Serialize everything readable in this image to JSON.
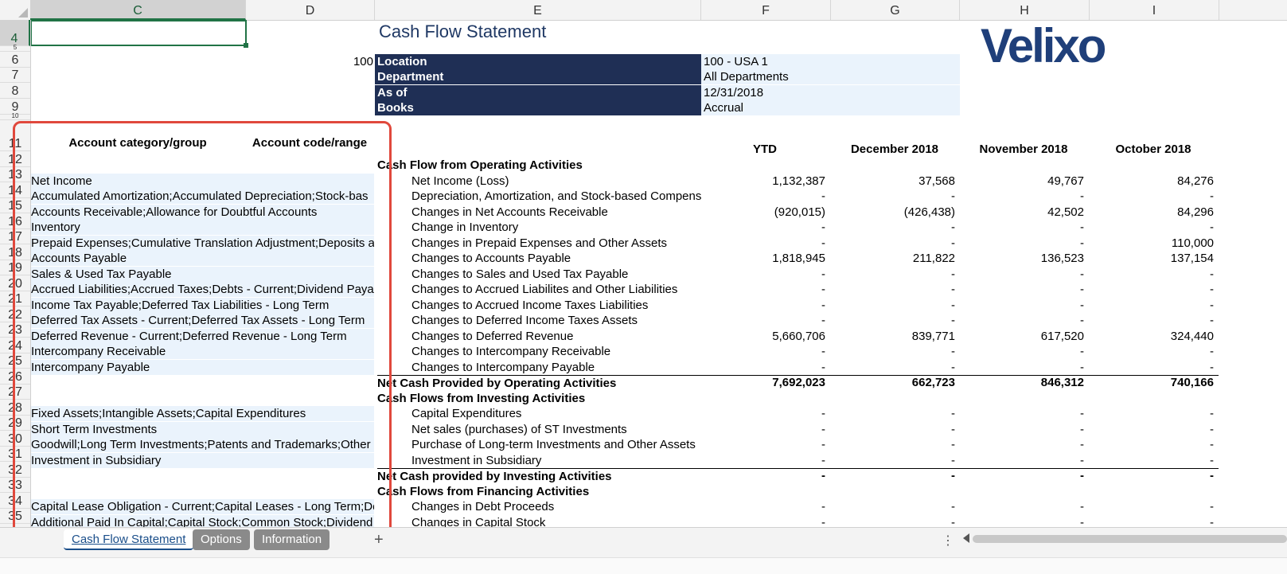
{
  "columns": [
    "C",
    "D",
    "E",
    "F",
    "G",
    "H",
    "I"
  ],
  "rows": [
    "4",
    "5",
    "6",
    "7",
    "8",
    "9",
    "10",
    "11",
    "12",
    "13",
    "14",
    "15",
    "16",
    "17",
    "18",
    "19",
    "20",
    "21",
    "22",
    "23",
    "24",
    "25",
    "26",
    "27",
    "28",
    "29",
    "30",
    "31",
    "32",
    "33",
    "34",
    "35"
  ],
  "report": {
    "title": "Cash Flow Statement",
    "location_code": "100",
    "header_labels": [
      "Location",
      "Department",
      "As of",
      "Books"
    ],
    "header_values": [
      "100 - USA 1",
      "All Departments",
      "12/31/2018",
      "Accrual"
    ],
    "logo_text": "Velixo"
  },
  "mapping_headers": {
    "category": "Account category/group",
    "code": "Account code/range"
  },
  "period_headers": [
    "YTD",
    "December 2018",
    "November 2018",
    "October 2018"
  ],
  "lines": [
    {
      "row": "12",
      "cat": "",
      "label": "Cash Flow from Operating Activities",
      "section": true,
      "vals": [
        "",
        "",
        "",
        ""
      ]
    },
    {
      "row": "13",
      "cat": "Net Income",
      "label": "Net Income (Loss)",
      "vals": [
        "1,132,387",
        "37,568",
        "49,767",
        "84,276"
      ]
    },
    {
      "row": "14",
      "cat": "Accumulated Amortization;Accumulated Depreciation;Stock-bas",
      "label": "Depreciation, Amortization, and Stock-based Compens",
      "vals": [
        "-",
        "-",
        "-",
        "-"
      ]
    },
    {
      "row": "15",
      "cat": "Accounts Receivable;Allowance for Doubtful Accounts",
      "label": "Changes in Net Accounts Receivable",
      "vals": [
        "(920,015)",
        "(426,438)",
        "42,502",
        "84,296"
      ]
    },
    {
      "row": "16",
      "cat": "Inventory",
      "label": "Change in Inventory",
      "vals": [
        "-",
        "-",
        "-",
        "-"
      ]
    },
    {
      "row": "17",
      "cat": "Prepaid Expenses;Cumulative Translation Adjustment;Deposits a",
      "label": "Changes in Prepaid Expenses and Other Assets",
      "vals": [
        "-",
        "-",
        "-",
        "110,000"
      ]
    },
    {
      "row": "18",
      "cat": "Accounts Payable",
      "label": "Changes to Accounts Payable",
      "vals": [
        "1,818,945",
        "211,822",
        "136,523",
        "137,154"
      ]
    },
    {
      "row": "19",
      "cat": "Sales & Used Tax Payable",
      "label": "Changes to Sales and Used Tax Payable",
      "vals": [
        "-",
        "-",
        "-",
        "-"
      ]
    },
    {
      "row": "20",
      "cat": "Accrued Liabilities;Accrued Taxes;Debts - Current;Dividend Payal",
      "label": "Changes to Accrued Liabilites and Other Liabilities",
      "vals": [
        "-",
        "-",
        "-",
        "-"
      ]
    },
    {
      "row": "21",
      "cat": "Income Tax Payable;Deferred Tax Liabilities - Long Term",
      "label": "Changes to Accrued Income Taxes Liabilities",
      "vals": [
        "-",
        "-",
        "-",
        "-"
      ]
    },
    {
      "row": "22",
      "cat": "Deferred Tax Assets - Current;Deferred Tax Assets - Long Term",
      "label": "Changes to Deferred Income Taxes Assets",
      "vals": [
        "-",
        "-",
        "-",
        "-"
      ]
    },
    {
      "row": "23",
      "cat": "Deferred Revenue - Current;Deferred Revenue - Long Term",
      "label": "Changes to Deferred Revenue",
      "vals": [
        "5,660,706",
        "839,771",
        "617,520",
        "324,440"
      ]
    },
    {
      "row": "24",
      "cat": "Intercompany Receivable",
      "label": "Changes to Intercompany Receivable",
      "vals": [
        "-",
        "-",
        "-",
        "-"
      ]
    },
    {
      "row": "25",
      "cat": "Intercompany Payable",
      "label": "Changes to Intercompany Payable",
      "vals": [
        "-",
        "-",
        "-",
        "-"
      ]
    },
    {
      "row": "26",
      "cat": "",
      "label": "Net Cash Provided by Operating Activities",
      "total": true,
      "vals": [
        "7,692,023",
        "662,723",
        "846,312",
        "740,166"
      ]
    },
    {
      "row": "27",
      "cat": "",
      "label": "Cash Flows from Investing Activities",
      "section": true,
      "vals": [
        "",
        "",
        "",
        ""
      ]
    },
    {
      "row": "28",
      "cat": "Fixed Assets;Intangible Assets;Capital Expenditures",
      "label": "Capital Expenditures",
      "vals": [
        "-",
        "-",
        "-",
        "-"
      ]
    },
    {
      "row": "29",
      "cat": "Short Term Investments",
      "label": "Net sales (purchases) of ST Investments",
      "vals": [
        "-",
        "-",
        "-",
        "-"
      ]
    },
    {
      "row": "30",
      "cat": "Goodwill;Long Term Investments;Patents and Trademarks;Other L",
      "label": "Purchase of Long-term Investments and Other Assets",
      "vals": [
        "-",
        "-",
        "-",
        "-"
      ]
    },
    {
      "row": "31",
      "cat": "Investment in Subsidiary",
      "label": "Investment in Subsidiary",
      "vals": [
        "-",
        "-",
        "-",
        "-"
      ]
    },
    {
      "row": "32",
      "cat": "",
      "label": "Net Cash provided by Investing Activities",
      "total": true,
      "vals": [
        "-",
        "-",
        "-",
        "-"
      ]
    },
    {
      "row": "33",
      "cat": "",
      "label": "Cash Flows from Financing Activities",
      "section": true,
      "vals": [
        "",
        "",
        "",
        ""
      ]
    },
    {
      "row": "34",
      "cat": "Capital Lease Obligation - Current;Capital Leases - Long Term;Del",
      "label": "Changes in Debt Proceeds",
      "vals": [
        "-",
        "-",
        "-",
        "-"
      ]
    },
    {
      "row": "35",
      "cat": "Additional Paid In Capital;Capital Stock;Common Stock;Dividend",
      "label": "Changes in Capital Stock",
      "vals": [
        "-",
        "-",
        "-",
        "-"
      ]
    }
  ],
  "sheet_tabs": [
    "Cash Flow Statement",
    "Options",
    "Information"
  ],
  "add_sheet": "+",
  "more": "⋮",
  "colors": {
    "accent_green": "#217346",
    "header_navy": "#1f2f55",
    "highlight": "#e0483c",
    "logo": "#1f3f7a"
  }
}
